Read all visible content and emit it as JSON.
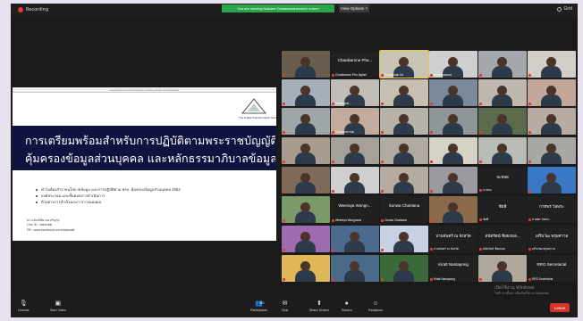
{
  "topbar": {
    "recording": "Recording",
    "share_banner": "You are viewing Natalee Chatanawanzzow's screen",
    "view_options": "View Options ˅",
    "right_label": "Grid"
  },
  "slide": {
    "url": "www.facebook.com/dataratsi   |   www.youtube.com/dataratsi",
    "logo_text": "The Digital Transformation Society",
    "title_line1": "การเตรียมพร้อมสำหรับการปฏิบัติตามพระราชบัญญัติ",
    "title_line2": "คุ้มครองข้อมูลส่วนบุคคล และหลักธรรมาภิบาลข้อมูล",
    "bullets": [
      "ทำไมต้องสำรวจนโยบายข้อมูล และการปฏิบัติตาม พรบ. คุ้มครองข้อมูลส่วนบุคคล 2562",
      "องค์ประกอบ และขั้นตอนการดำเนินการ",
      "ตัวอย่างการสำเร็จและการวางแผนผล"
    ],
    "contact": [
      "ดร.อนันต์ชัย คงเจริญรุ่ง",
      "Line ID : dataratsi",
      "FB : www.facebook.com/dataratsi"
    ]
  },
  "participants": [
    {
      "name": "",
      "c": "#6b5d4e"
    },
    {
      "name": "Chanikarnne Pha...",
      "sub": "Chanikarnne Phn-Nghail",
      "c": "#202020",
      "big": true
    },
    {
      "name": "Punyaphan Ha",
      "c": "#c9c4b6",
      "spk": true
    },
    {
      "name": "mpaipiyachart",
      "c": "#cfcfcf"
    },
    {
      "name": "",
      "c": "#a4a8ad"
    },
    {
      "name": "",
      "c": "#d3cfc8"
    },
    {
      "name": "",
      "c": "#a6b0bb"
    },
    {
      "name": "Nantiwipat...",
      "c": "#c0bdb6"
    },
    {
      "name": "",
      "c": "#c7bfb2"
    },
    {
      "name": "",
      "c": "#7a8a9a"
    },
    {
      "name": "",
      "c": "#c0b8ae"
    },
    {
      "name": "",
      "c": "#c2a79a"
    },
    {
      "name": "",
      "c": "#9fa6aa"
    },
    {
      "name": "Chananee Kao",
      "c": "#c3ab9e"
    },
    {
      "name": "",
      "c": "#b7b2a8"
    },
    {
      "name": "",
      "c": "#8f9699"
    },
    {
      "name": "",
      "c": "#5a6a4a"
    },
    {
      "name": "",
      "c": "#b8aba3"
    },
    {
      "name": "",
      "c": "#a99c8e"
    },
    {
      "name": "",
      "c": "#a6a09a"
    },
    {
      "name": "",
      "c": "#b0aaa3"
    },
    {
      "name": "",
      "c": "#d7d2c6"
    },
    {
      "name": "",
      "c": "#b9bcb6"
    },
    {
      "name": "",
      "c": "#a7a8a3"
    },
    {
      "name": "",
      "c": "#7f6a5a"
    },
    {
      "name": "",
      "c": "#cfcfcf"
    },
    {
      "name": "",
      "c": "#b5aba1"
    },
    {
      "name": "",
      "c": "#9a9aa0"
    },
    {
      "name": "จะหลอ",
      "sub": "จะหลอ",
      "c": "#202020",
      "big": true
    },
    {
      "name": "",
      "c": "#3a78c6"
    },
    {
      "name": "",
      "c": "#7a9a6a"
    },
    {
      "name": "Weeraya Wongn...",
      "sub": "Weeraya Wongnarat",
      "c": "#202020",
      "big": true
    },
    {
      "name": "Sunwa Chantana",
      "sub": "Cewaa Chantana",
      "c": "#202020",
      "big": true
    },
    {
      "name": "",
      "c": "#8b6a4a"
    },
    {
      "name": "ชัยพี",
      "sub": "ชัยพี",
      "c": "#202020",
      "big": true
    },
    {
      "name": "กาทพร วัลพระ",
      "sub": "กาทพร วัลพระ",
      "c": "#202020",
      "big": true
    },
    {
      "name": "",
      "c": "#9e6ab0"
    },
    {
      "name": "",
      "c": "#4c6a8e"
    },
    {
      "name": "",
      "c": "#c8d0e4"
    },
    {
      "name": "ปานจันทร์ ณ จังหวัด",
      "sub": "ปานจันทร์ ณ จังหวัด",
      "c": "#202020",
      "big": true
    },
    {
      "name": "สนัทรัตน์ ช้อยกมล...",
      "sub": "สนัทรัตน์ ช้อยกมล",
      "c": "#202020",
      "big": true
    },
    {
      "name": "เสริมวัฒ พรุมศาวล",
      "sub": "เสริมวัฒ พรุมศาวล",
      "c": "#202020",
      "big": true
    },
    {
      "name": "",
      "c": "#e0b85a"
    },
    {
      "name": "",
      "c": "#4a6a8a"
    },
    {
      "name": "",
      "c": "#3a6a3a"
    },
    {
      "name": "Kiratt Nantapong",
      "sub": "Kiratt Nantapong",
      "c": "#202020",
      "big": true
    },
    {
      "name": "",
      "c": "#b0a89a"
    },
    {
      "name": "RRG Secretariat",
      "sub": "RRG Secretariat",
      "c": "#202020",
      "big": true
    }
  ],
  "toolbar": {
    "items": [
      {
        "label": "Unmute",
        "icon": "🎙"
      },
      {
        "label": "Start Video",
        "icon": "▣"
      },
      {
        "label": "Participants",
        "icon": "👥"
      },
      {
        "label": "Chat",
        "icon": "✉"
      },
      {
        "label": "Share Screen",
        "icon": "⬆"
      },
      {
        "label": "Record",
        "icon": "●"
      },
      {
        "label": "Reactions",
        "icon": "☺"
      }
    ],
    "participants_count": "55",
    "leave": "Leave"
  },
  "watermark": {
    "line1": "เปิดใช้งาน Windows",
    "line2": "ไปที่ การตั้งค่า เพื่อเปิดใช้งาน Windows"
  },
  "colors": {
    "slide_band": "#10133f",
    "share_green": "#2ba54a",
    "leave_red": "#d6322c"
  }
}
